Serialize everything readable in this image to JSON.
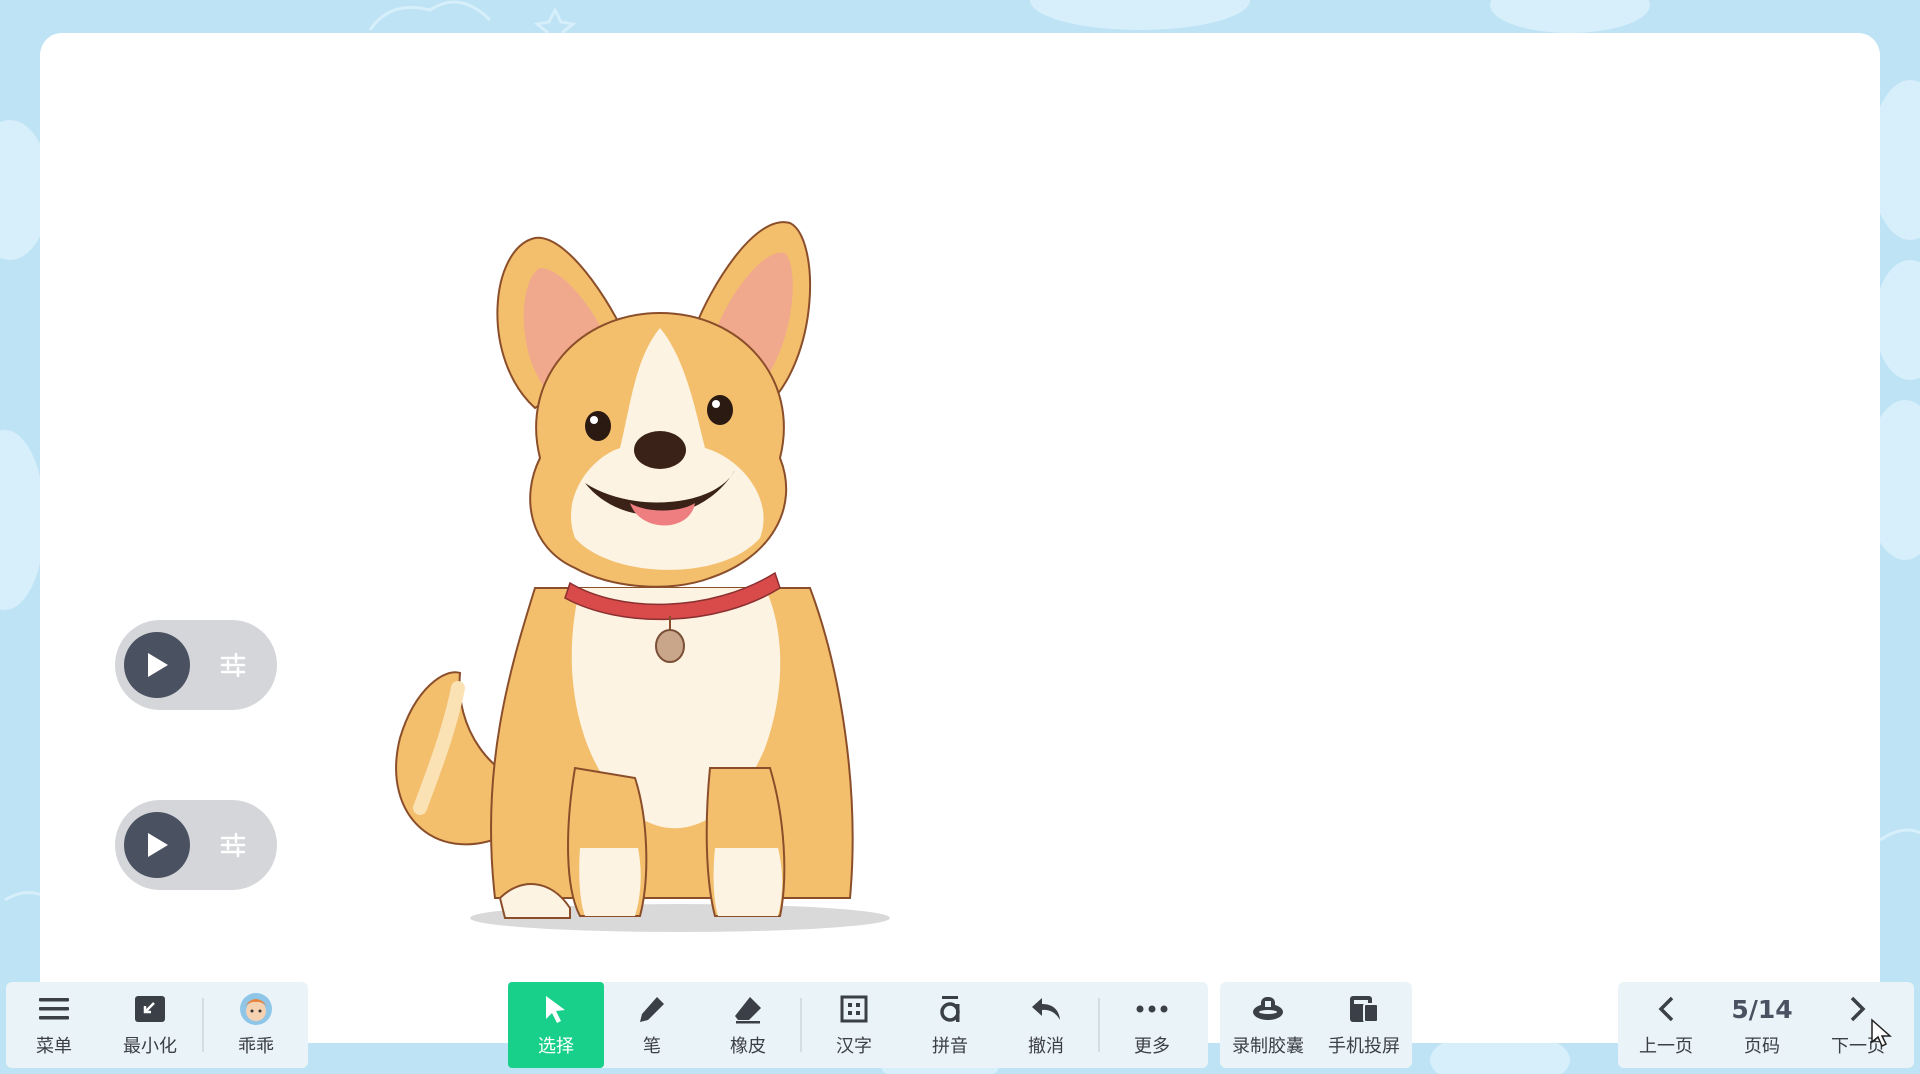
{
  "left_toolbar": {
    "menu": "菜单",
    "minimize": "最小化",
    "user": "乖乖"
  },
  "main_toolbar": {
    "select": "选择",
    "pen": "笔",
    "eraser": "橡皮",
    "hanzi": "汉字",
    "pinyin": "拼音",
    "undo": "撤消",
    "more": "更多"
  },
  "right_toolbar": {
    "record": "录制胶囊",
    "phone_cast": "手机投屏"
  },
  "pager": {
    "prev": "上一页",
    "page_value": "5/14",
    "page_label": "页码",
    "next": "下一页"
  },
  "colors": {
    "active_tool": "#19d08a",
    "background": "#bde3f5",
    "toolbar": "#eaf3f7"
  }
}
